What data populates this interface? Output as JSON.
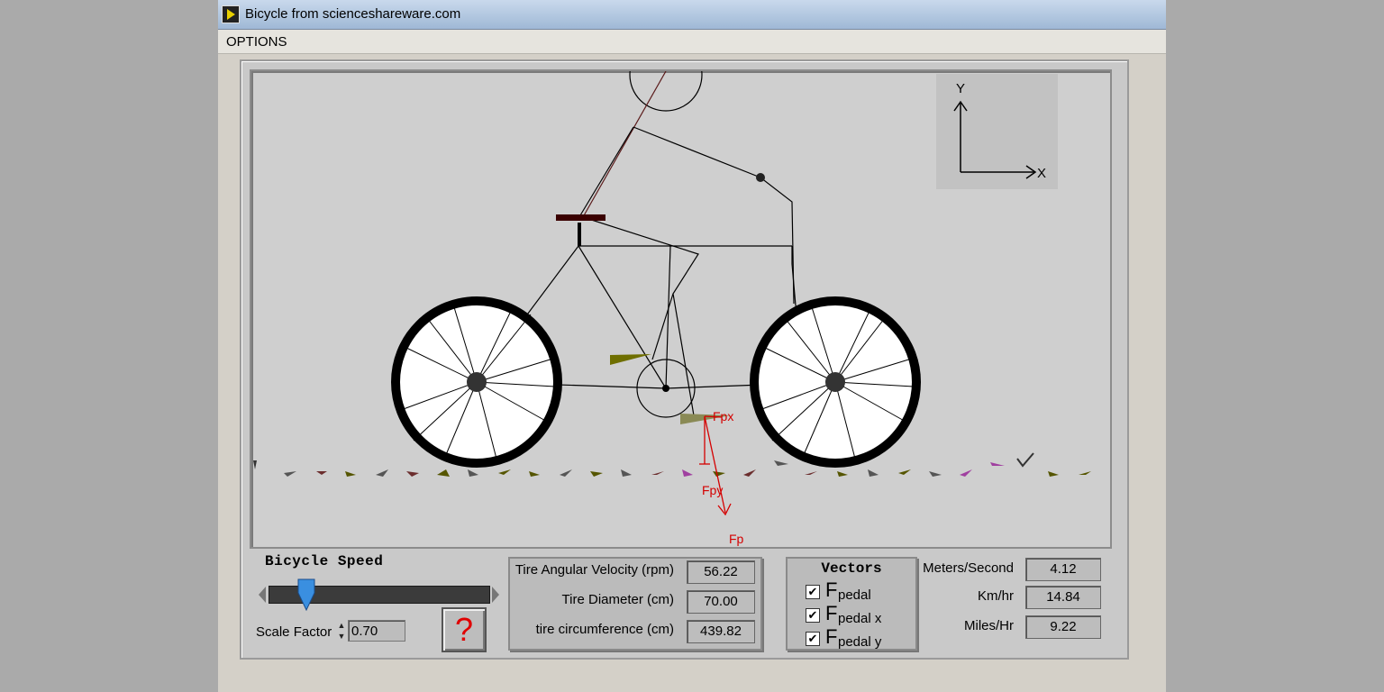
{
  "window": {
    "title": "Bicycle from scienceshareware.com"
  },
  "menu": {
    "options": "OPTIONS"
  },
  "scene": {
    "axis_y": "Y",
    "axis_x": "X",
    "labels": {
      "fpx": "Fpx",
      "fpy": "Fpy",
      "fp": "Fp"
    }
  },
  "controls": {
    "speed_label": "Bicycle Speed",
    "speed_slider_fraction": 0.17,
    "scale_label": "Scale Factor",
    "scale_value": "0.70",
    "help_label": "?"
  },
  "tire": [
    {
      "label": "Tire Angular Velocity (rpm)",
      "value": "56.22"
    },
    {
      "label": "Tire Diameter (cm)",
      "value": "70.00"
    },
    {
      "label": "tire circumference (cm)",
      "value": "439.82"
    }
  ],
  "vectors": {
    "title": "Vectors",
    "items": [
      {
        "prefix": "F",
        "sub": "pedal",
        "checked": true
      },
      {
        "prefix": "F",
        "sub": "pedal x",
        "checked": true
      },
      {
        "prefix": "F",
        "sub": "pedal y",
        "checked": true
      }
    ],
    "check_mark": "✔"
  },
  "speed": [
    {
      "label": "Meters/Second",
      "value": "4.12"
    },
    {
      "label": "Km/hr",
      "value": "14.84"
    },
    {
      "label": "Miles/Hr",
      "value": "9.22"
    }
  ],
  "colors": {
    "vector_red": "#d40000",
    "pedal_olive": "#6f6f00",
    "seat": "#3a0000"
  }
}
